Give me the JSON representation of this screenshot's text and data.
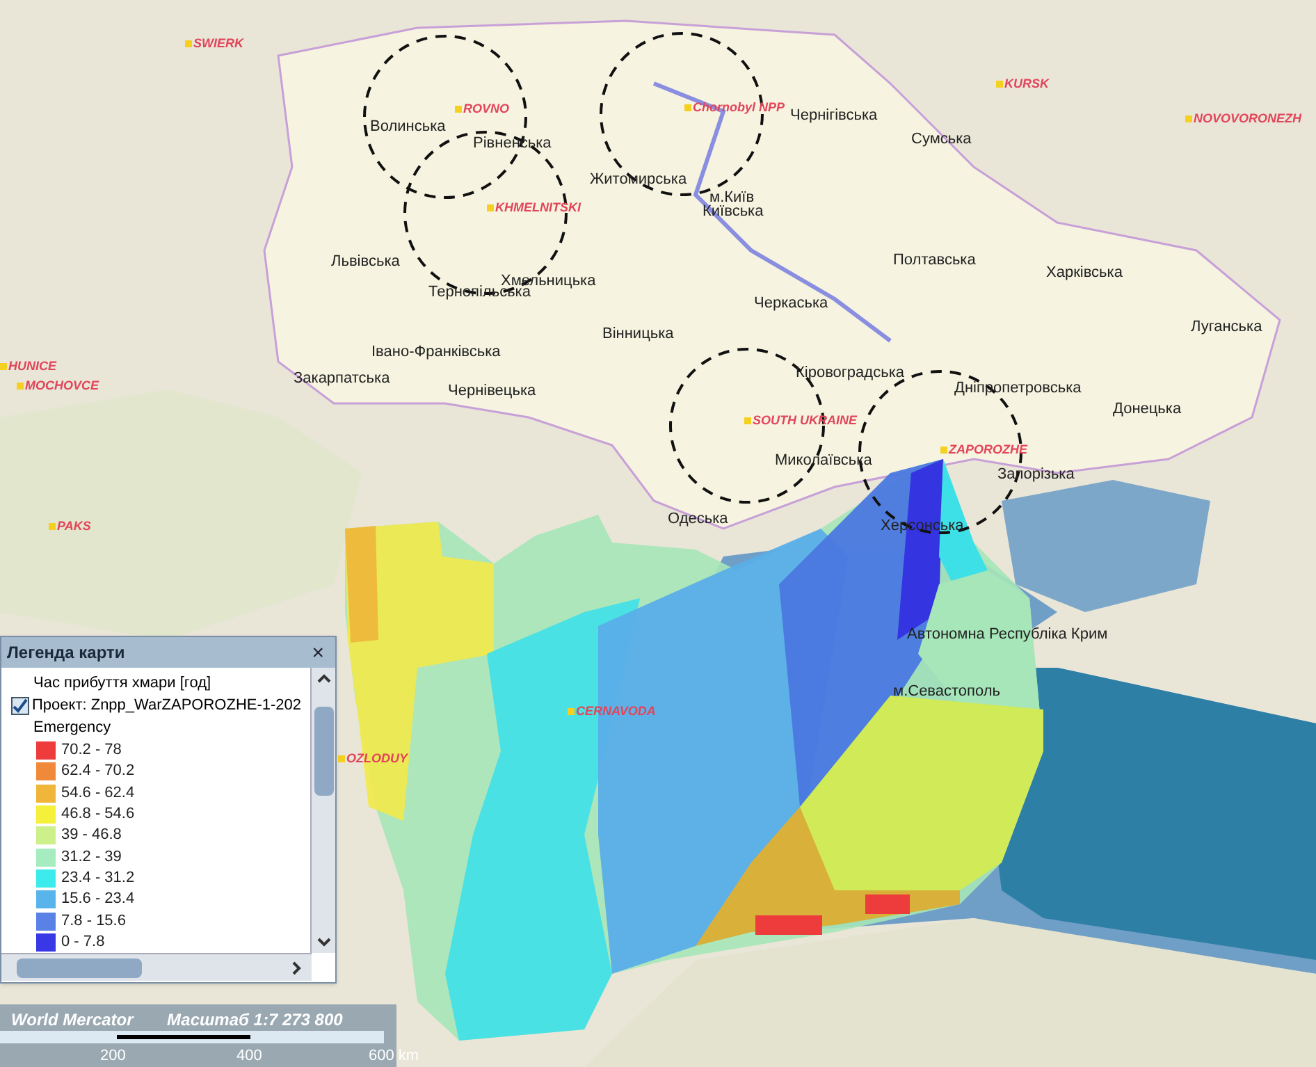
{
  "map": {
    "plant_labels": [
      "SWIERK",
      "ROVNO",
      "KHMELNITSKI",
      "Chornobyl NPP",
      "KURSK",
      "NOVOVORONEZH",
      "HUNICE",
      "MOCHOVCE",
      "PAKS",
      "SOUTH UKRAINE",
      "ZAPOROZHE",
      "CERNAVODA",
      "OZLODUY"
    ],
    "region_labels": [
      "Волинська",
      "Рівненська",
      "Житомирська",
      "м.Київ",
      "Київська",
      "Чернігівська",
      "Сумська",
      "Львівська",
      "Хмельницька",
      "Тернопільська",
      "Полтавська",
      "Харківська",
      "Черкаська",
      "Вінницька",
      "Луганська",
      "Івано-Франківська",
      "Закарпатська",
      "Чернівецька",
      "Кіровоградська",
      "Дніпропетровська",
      "Донецька",
      "Миколаївська",
      "Одеська",
      "Запорізька",
      "Херсонська",
      "Автономна Республіка Крим",
      "м.Севастополь"
    ]
  },
  "legend": {
    "title": "Легенда карти",
    "close": "×",
    "layer_title": "Час прибуття хмари [год]",
    "project": {
      "label": "Проект: Znpp_WarZAPOROZHE-1-202",
      "checked": true
    },
    "group": "Emergency",
    "classes": [
      {
        "label": "70.2 - 78",
        "color": "#ee3b3b"
      },
      {
        "label": "62.4 - 70.2",
        "color": "#f08a3a"
      },
      {
        "label": "54.6 - 62.4",
        "color": "#f0b63a"
      },
      {
        "label": "46.8 - 54.6",
        "color": "#f5f03a"
      },
      {
        "label": "39 - 46.8",
        "color": "#cdf08a"
      },
      {
        "label": "31.2 - 39",
        "color": "#a6ecc0"
      },
      {
        "label": "23.4 - 31.2",
        "color": "#3cecec"
      },
      {
        "label": "15.6 - 23.4",
        "color": "#5ab4ec"
      },
      {
        "label": "7.8 - 15.6",
        "color": "#5a82e6"
      },
      {
        "label": "0 - 7.8",
        "color": "#3838e6"
      }
    ]
  },
  "status_bar": {
    "projection": "World Mercator",
    "scale": "Масштаб 1:7 273 800",
    "scale_ticks": [
      "200",
      "400",
      "600 km"
    ]
  }
}
